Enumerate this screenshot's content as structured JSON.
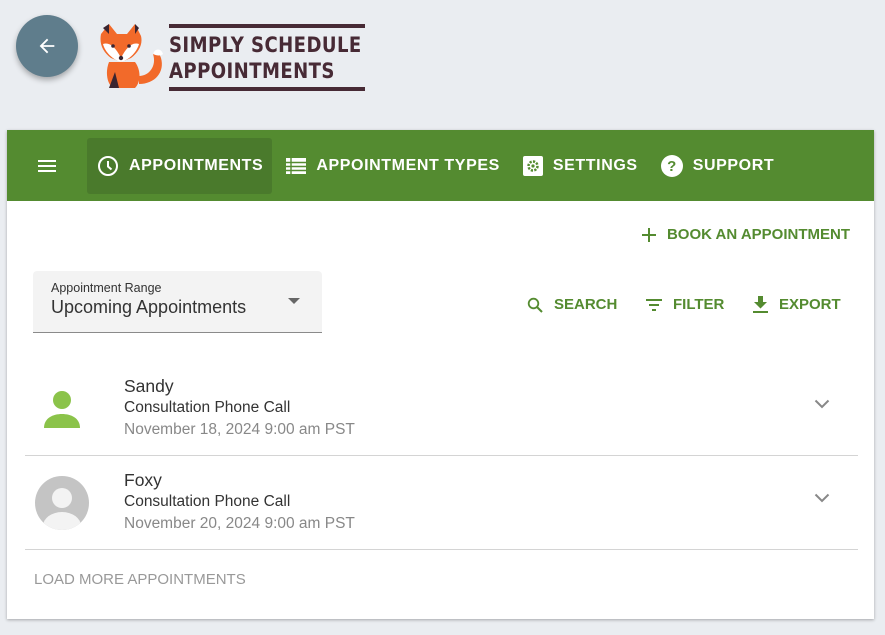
{
  "header": {
    "back_icon": "arrow-left-icon",
    "logo_line1": "SIMPLY SCHEDULE",
    "logo_line2": "APPOINTMENTS",
    "logo_icon": "fox-mascot-icon"
  },
  "nav": {
    "menu_icon": "hamburger-menu-icon",
    "items": [
      {
        "label": "APPOINTMENTS",
        "icon": "clock-icon",
        "active": true
      },
      {
        "label": "APPOINTMENT TYPES",
        "icon": "list-table-icon",
        "active": false
      },
      {
        "label": "SETTINGS",
        "icon": "gear-icon",
        "active": false
      },
      {
        "label": "SUPPORT",
        "icon": "help-circle-icon",
        "active": false
      }
    ]
  },
  "toolbar": {
    "book_label": "BOOK AN APPOINTMENT",
    "search_label": "SEARCH",
    "filter_label": "FILTER",
    "export_label": "EXPORT"
  },
  "range": {
    "label": "Appointment Range",
    "value": "Upcoming Appointments"
  },
  "appointments": [
    {
      "name": "Sandy",
      "type": "Consultation Phone Call",
      "date": "November 18, 2024 9:00 am PST",
      "avatar": "person-icon"
    },
    {
      "name": "Foxy",
      "type": "Consultation Phone Call",
      "date": "November 20, 2024 9:00 am PST",
      "avatar": "default-avatar-icon"
    }
  ],
  "load_more_label": "LOAD MORE APPOINTMENTS",
  "colors": {
    "brand_green": "#548b30",
    "active_nav": "#4a7a2c",
    "back_button": "#5f7d8c",
    "logo_text": "#472a35",
    "fox_orange": "#f26a2a"
  }
}
